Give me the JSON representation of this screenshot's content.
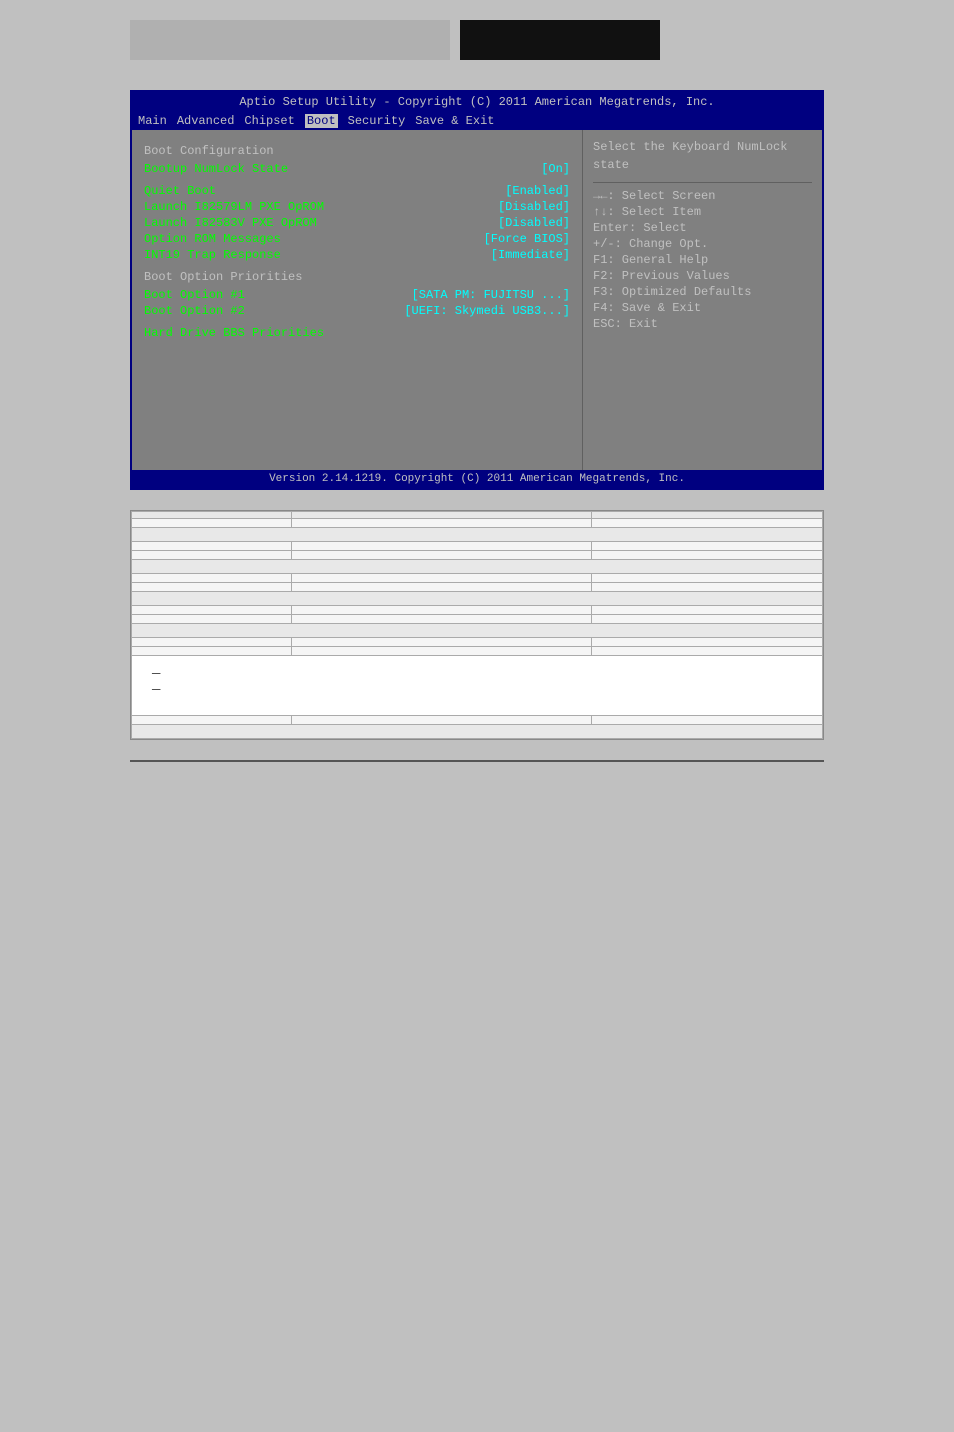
{
  "topHeader": {
    "leftBlockColor": "#b0b0b0",
    "rightBlockColor": "#111111"
  },
  "bios": {
    "titleBar": "Aptio Setup Utility - Copyright (C) 2011 American Megatrends, Inc.",
    "menuItems": [
      "Main",
      "Advanced",
      "Chipset",
      "Boot",
      "Security",
      "Save & Exit"
    ],
    "activeMenu": "Boot",
    "leftPanel": {
      "sectionHeader": "Boot Configuration",
      "rows": [
        {
          "label": "Bootup NumLock State",
          "value": "[On]"
        },
        {
          "label": "",
          "value": ""
        },
        {
          "label": "Quiet Boot",
          "value": "[Enabled]"
        },
        {
          "label": "Launch I82579LM PXE OpROM",
          "value": "[Disabled]"
        },
        {
          "label": "Launch I82583V PXE OpROM",
          "value": "[Disabled]"
        },
        {
          "label": "Option ROM Messages",
          "value": "[Force BIOS]"
        },
        {
          "label": "INT19 Trap Response",
          "value": "[Immediate]"
        },
        {
          "label": "",
          "value": ""
        },
        {
          "label": "Boot Option Priorities",
          "value": ""
        },
        {
          "label": "Boot Option #1",
          "value": "[SATA PM: FUJITSU ...]"
        },
        {
          "label": "Boot Option #2",
          "value": "[UEFI: Skymedi USB3...]"
        },
        {
          "label": "",
          "value": ""
        },
        {
          "label": "Hard Drive BBS Priorities",
          "value": ""
        }
      ]
    },
    "rightPanel": {
      "helpText": "Select the Keyboard NumLock state",
      "shortcuts": [
        "→←: Select Screen",
        "↑↓: Select Item",
        "Enter: Select",
        "+/-: Change Opt.",
        "F1: General Help",
        "F2: Previous Values",
        "F3: Optimized Defaults",
        "F4: Save & Exit",
        "ESC: Exit"
      ]
    },
    "footer": "Version 2.14.1219. Copyright (C) 2011 American Megatrends, Inc."
  },
  "tableSection": {
    "rows": [
      {
        "type": "header",
        "col1": "",
        "col2": "",
        "col3": ""
      },
      {
        "type": "data",
        "col1": "",
        "col2": "",
        "col3": ""
      },
      {
        "type": "section",
        "col1": "",
        "col2": "",
        "col3": ""
      },
      {
        "type": "data",
        "col1": "",
        "col2": "",
        "col3": ""
      },
      {
        "type": "data",
        "col1": "",
        "col2": "",
        "col3": ""
      },
      {
        "type": "section",
        "col1": "",
        "col2": "",
        "col3": ""
      },
      {
        "type": "data",
        "col1": "",
        "col2": "",
        "col3": ""
      },
      {
        "type": "data",
        "col1": "",
        "col2": "",
        "col3": ""
      },
      {
        "type": "section",
        "col1": "",
        "col2": "",
        "col3": ""
      },
      {
        "type": "data",
        "col1": "",
        "col2": "",
        "col3": ""
      },
      {
        "type": "data",
        "col1": "",
        "col2": "",
        "col3": ""
      },
      {
        "type": "section",
        "col1": "",
        "col2": "",
        "col3": ""
      },
      {
        "type": "data",
        "col1": "",
        "col2": "",
        "col3": ""
      },
      {
        "type": "data",
        "col1": "",
        "col2": "",
        "col3": ""
      },
      {
        "type": "group",
        "col1": "—\n—",
        "col2": "",
        "col3": ""
      },
      {
        "type": "data",
        "col1": "",
        "col2": "",
        "col3": ""
      },
      {
        "type": "footer",
        "col1": "",
        "col2": "",
        "col3": ""
      }
    ]
  }
}
